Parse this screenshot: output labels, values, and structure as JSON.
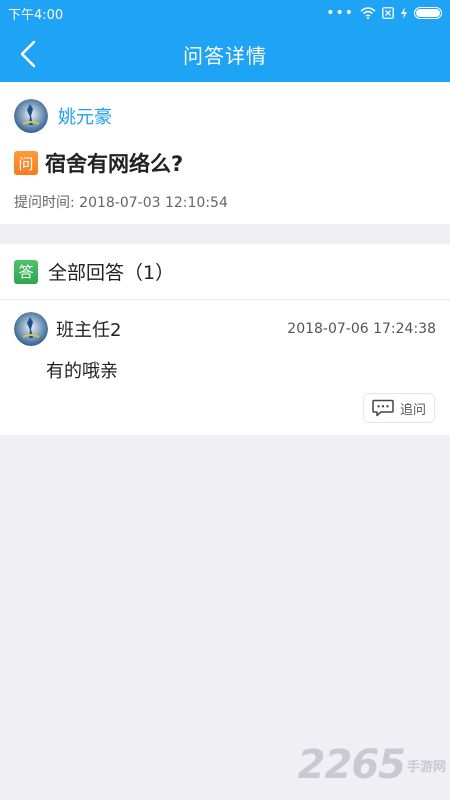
{
  "status_bar": {
    "time": "下午4:00"
  },
  "nav": {
    "title": "问答详情",
    "back_icon": "chevron-left-icon"
  },
  "question": {
    "asker": "姚元豪",
    "badge": "问",
    "text": "宿舍有网络么?",
    "time_label": "提问时间: 2018-07-03 12:10:54"
  },
  "answers": {
    "badge": "答",
    "title": "全部回答（1）",
    "items": [
      {
        "answerer": "班主任2",
        "time": "2018-07-06 17:24:38",
        "text": "有的哦亲",
        "followup_label": "追问"
      }
    ]
  },
  "watermark": {
    "number": "2265",
    "text": "手游网"
  },
  "colors": {
    "primary": "#1fa3f5",
    "asker_name": "#1e9fe8",
    "question_badge": "#f57c1f",
    "answer_badge": "#2ea64e",
    "background": "#efeff4"
  }
}
